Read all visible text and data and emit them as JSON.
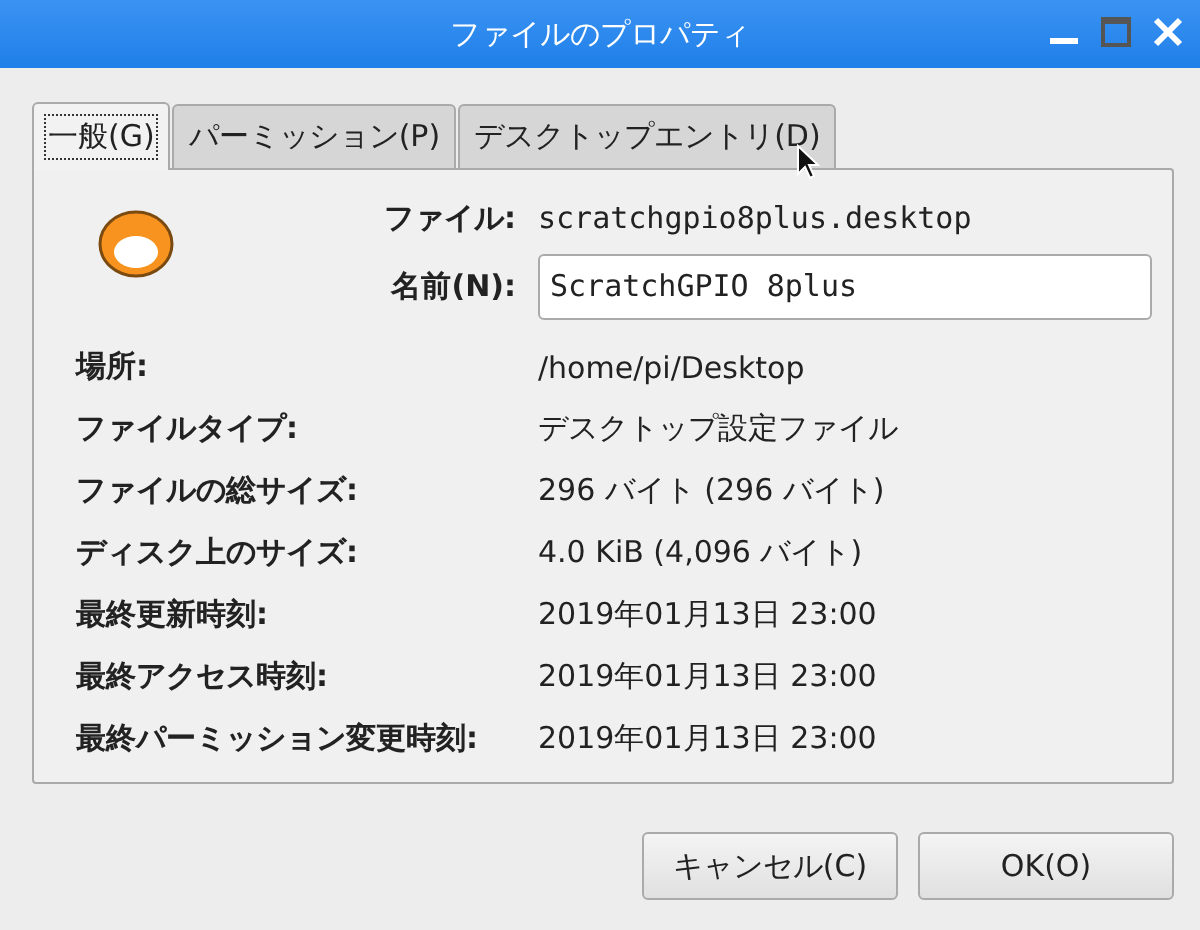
{
  "window": {
    "title": "ファイルのプロパティ"
  },
  "tabs": [
    {
      "label": "一般(G)",
      "selected": true
    },
    {
      "label": "パーミッション(P)",
      "selected": false
    },
    {
      "label": "デスクトップエントリ(D)",
      "selected": false
    }
  ],
  "header": {
    "file_label": "ファイル:",
    "file_value": "scratchgpio8plus.desktop",
    "name_label": "名前(N):",
    "name_value": "ScratchGPIO 8plus"
  },
  "properties": [
    {
      "label": "場所:",
      "value": "/home/pi/Desktop"
    },
    {
      "label": "ファイルタイプ:",
      "value": "デスクトップ設定ファイル"
    },
    {
      "label": "ファイルの総サイズ:",
      "value": "296 バイト (296 バイト)"
    },
    {
      "label": "ディスク上のサイズ:",
      "value": "4.0 KiB (4,096 バイト)"
    },
    {
      "label": "最終更新時刻:",
      "value": "2019年01月13日 23:00"
    },
    {
      "label": "最終アクセス時刻:",
      "value": "2019年01月13日 23:00"
    },
    {
      "label": "最終パーミッション変更時刻:",
      "value": "2019年01月13日 23:00"
    }
  ],
  "buttons": [
    "キャンセル(C)",
    "OK(O)"
  ]
}
